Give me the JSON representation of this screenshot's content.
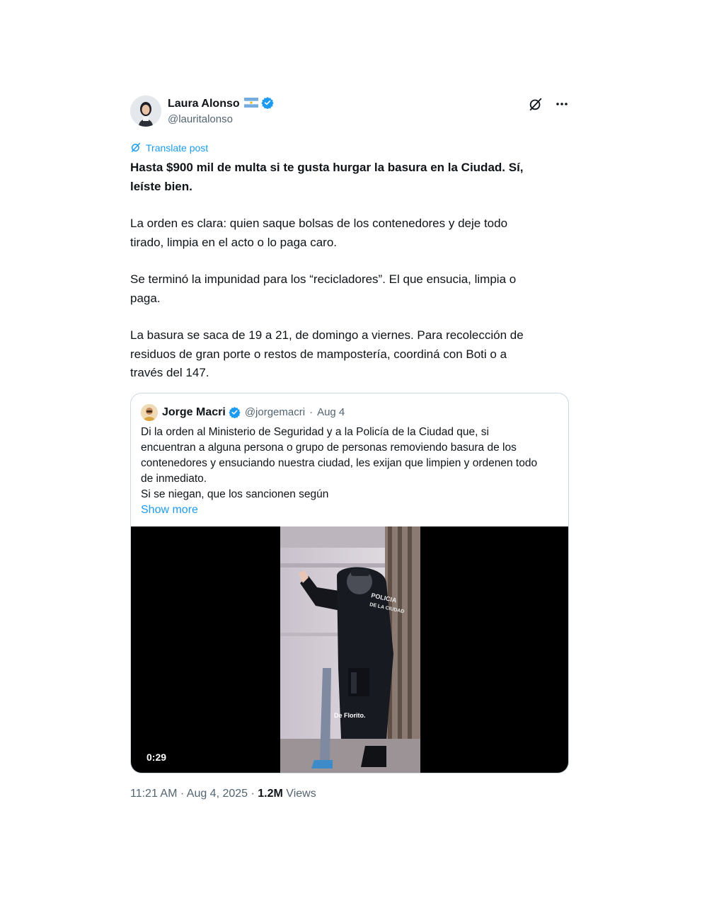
{
  "author": {
    "display_name": "Laura Alonso",
    "handle": "@lauritalonso",
    "flag_icon": "argentina-flag-icon",
    "verified_icon": "verified-badge-icon"
  },
  "translate_label": "Translate post",
  "post": {
    "headline_line1": "Hasta $900 mil de multa si te gusta hurgar la basura en la Ciudad. Sí,",
    "headline_line2": "leíste bien.",
    "para1_line1": "La orden es clara: quien saque bolsas de los contenedores y deje todo",
    "para1_line2": "tirado, limpia en el acto o lo paga caro.",
    "para2_line1": "Se terminó la impunidad para los “recicladores”. El que ensucia, limpia o",
    "para2_line2": "paga.",
    "para3_line1": "La basura se saca de 19 a 21, de domingo a viernes. Para recolección de",
    "para3_line2": "residuos de gran porte o restos de mampostería, coordiná con Boti o a",
    "para3_line3": "través del 147."
  },
  "quote": {
    "display_name": "Jorge Macri",
    "handle": "@jorgemacri",
    "separator": "·",
    "date": "Aug 4",
    "line1": "Di la orden al Ministerio de Seguridad y a la Policía de la Ciudad que, si",
    "line2": "encuentran a alguna persona o grupo de personas removiendo basura de los",
    "line3": "contenedores y ensuciando nuestra ciudad, les exijan que limpien y ordenen todo",
    "line4": "de inmediato.",
    "line5": "Si se niegan, que los sancionen según",
    "show_more": "Show more",
    "video": {
      "duration": "0:29",
      "subtitle": "De Florito.",
      "vest_text": "POLICIA DE LA CIUDAD"
    }
  },
  "footer": {
    "time": "11:21 AM",
    "sep1": " · ",
    "date": "Aug 4, 2025",
    "sep2": " · ",
    "views_count": "1.2M",
    "views_label": " Views"
  },
  "colors": {
    "accent": "#1d9bf0",
    "text": "#0f1419",
    "muted": "#536471",
    "border": "#cfd9de"
  }
}
